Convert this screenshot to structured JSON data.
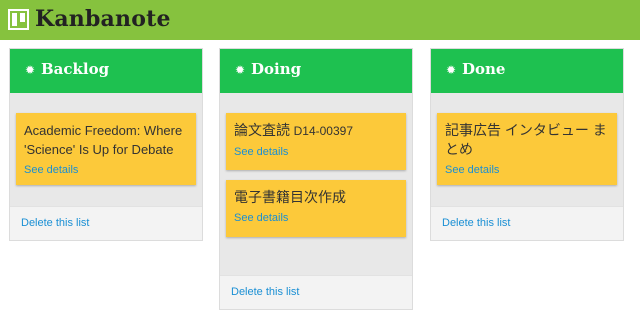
{
  "app": {
    "name": "Kanbanote"
  },
  "lists": [
    {
      "title": "Backlog",
      "cards": [
        {
          "title": "Academic Freedom: Where 'Science' Is Up for Debate",
          "details_label": "See details"
        }
      ],
      "delete_label": "Delete this list"
    },
    {
      "title": "Doing",
      "cards": [
        {
          "title_main": "論文査読",
          "title_code": "D14-00397",
          "details_label": "See details"
        },
        {
          "title": "電子書籍目次作成",
          "details_label": "See details"
        }
      ],
      "delete_label": "Delete this list"
    },
    {
      "title": "Done",
      "cards": [
        {
          "title": "記事広告 インタビュー まとめ",
          "details_label": "See details"
        }
      ],
      "delete_label": "Delete this list"
    }
  ],
  "colors": {
    "topbar": "#86c23e",
    "list_header": "#1ec150",
    "card": "#fcc93a",
    "link": "#1a8fd4"
  }
}
